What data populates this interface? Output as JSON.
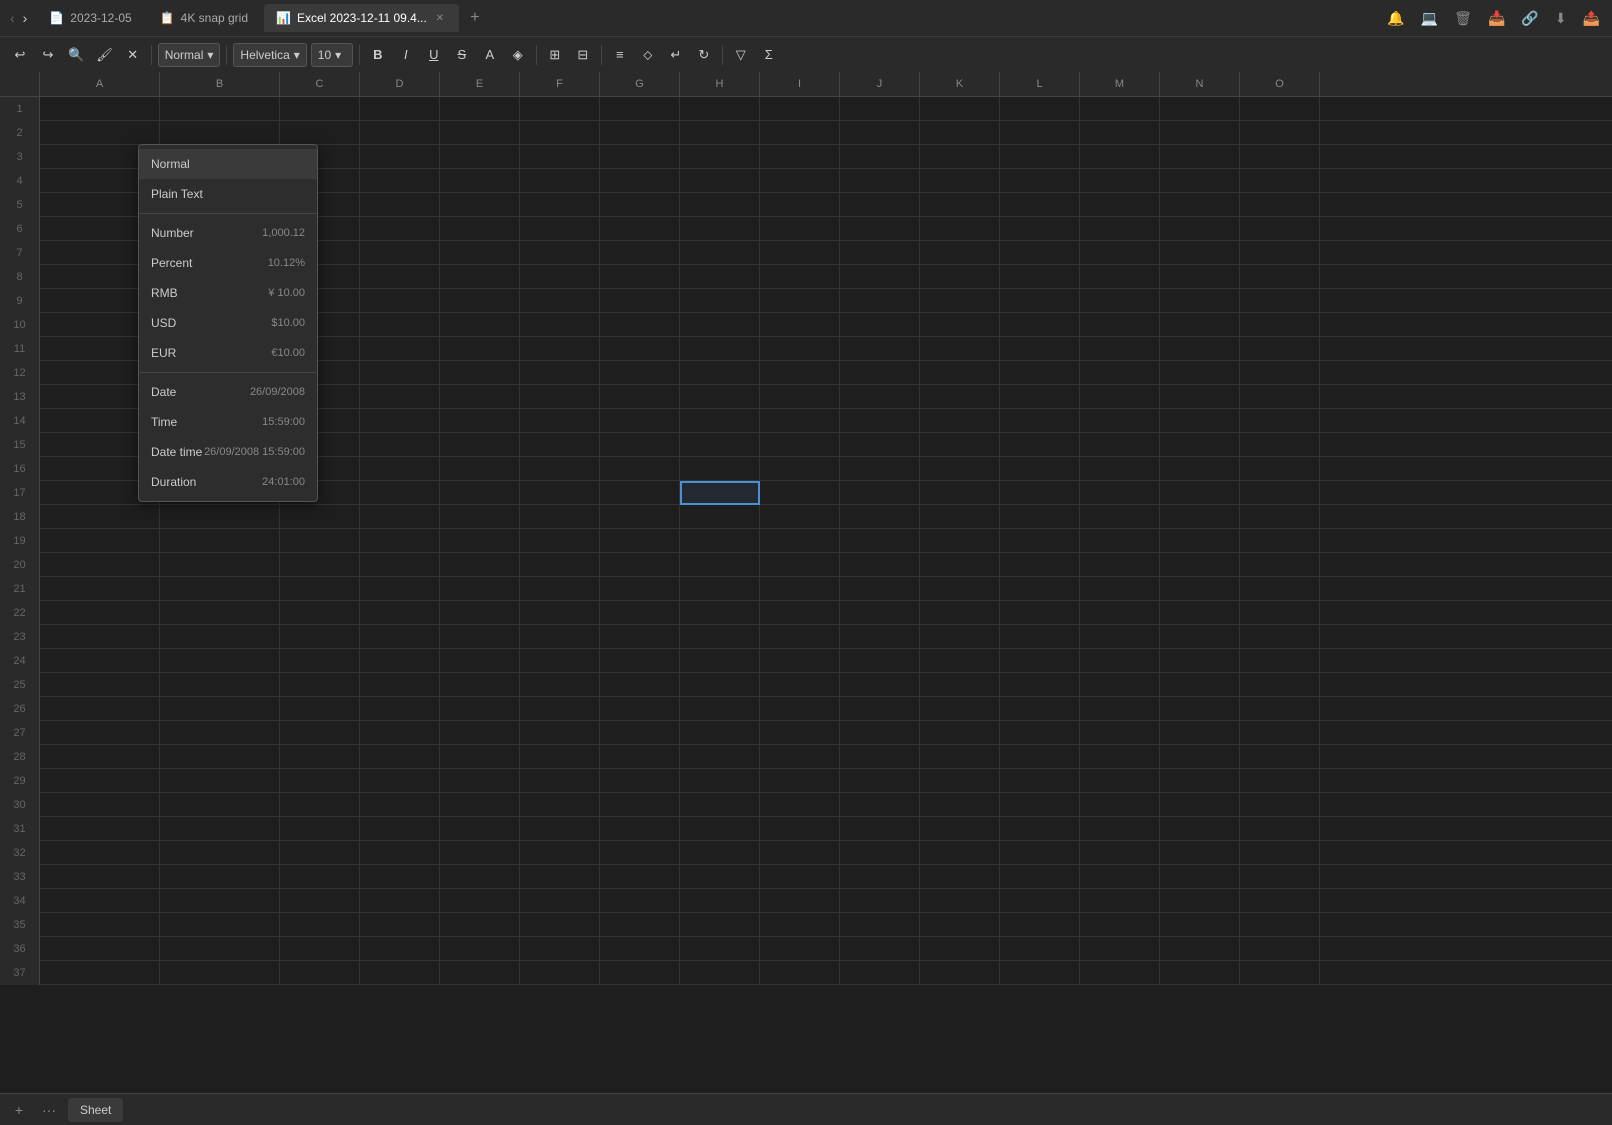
{
  "title_bar": {
    "tabs": [
      {
        "id": "tab1",
        "icon": "📄",
        "label": "2023-12-05",
        "active": false,
        "closeable": false
      },
      {
        "id": "tab2",
        "icon": "📋",
        "label": "4K snap grid",
        "active": false,
        "closeable": false
      },
      {
        "id": "tab3",
        "icon": "📊",
        "label": "Excel 2023-12-11 09.4...",
        "active": true,
        "closeable": true
      }
    ],
    "add_tab_label": "+",
    "right_icons": [
      "🔔",
      "💻",
      "🗑",
      "📥",
      "🔗",
      "⬇",
      "📤"
    ]
  },
  "toolbar": {
    "undo_label": "↩",
    "redo_label": "↪",
    "search_label": "🔍",
    "format_paint_label": "🖌",
    "clear_label": "✕",
    "format_style": "Normal",
    "font_family": "Helvetica",
    "font_size": "10",
    "bold_label": "B",
    "italic_label": "I",
    "underline_label": "U",
    "strikethrough_label": "S",
    "text_color_label": "A",
    "fill_color_label": "◈",
    "borders_label": "⊞",
    "merge_label": "⊟",
    "align_label": "≡",
    "valign_label": "⬦",
    "wrap_label": "↵",
    "rotate_label": "↻",
    "filter_label": "▽",
    "sum_label": "Σ"
  },
  "format_dropdown": {
    "visible": true,
    "selected": "Normal",
    "items": [
      {
        "label": "Normal",
        "value": "",
        "type": "option",
        "highlighted": true
      },
      {
        "label": "Plain Text",
        "value": "",
        "type": "option"
      },
      {
        "type": "divider"
      },
      {
        "label": "Number",
        "value": "1,000.12",
        "type": "option"
      },
      {
        "label": "Percent",
        "value": "10.12%",
        "type": "option"
      },
      {
        "label": "RMB",
        "value": "¥ 10.00",
        "type": "option"
      },
      {
        "label": "USD",
        "value": "$10.00",
        "type": "option"
      },
      {
        "label": "EUR",
        "value": "€10.00",
        "type": "option"
      },
      {
        "type": "divider"
      },
      {
        "label": "Date",
        "value": "26/09/2008",
        "type": "option"
      },
      {
        "label": "Time",
        "value": "15:59:00",
        "type": "option"
      },
      {
        "label": "Date time",
        "value": "26/09/2008 15:59:00",
        "type": "option"
      },
      {
        "label": "Duration",
        "value": "24:01:00",
        "type": "option"
      }
    ]
  },
  "columns": [
    "A",
    "B",
    "C",
    "D",
    "E",
    "F",
    "G",
    "H",
    "I",
    "J",
    "K",
    "L",
    "M",
    "N",
    "O"
  ],
  "rows": 37,
  "selected_cell": {
    "row": 17,
    "col": "H"
  },
  "bottom_bar": {
    "add_sheet_label": "+",
    "more_label": "···",
    "sheet_label": "Sheet"
  }
}
